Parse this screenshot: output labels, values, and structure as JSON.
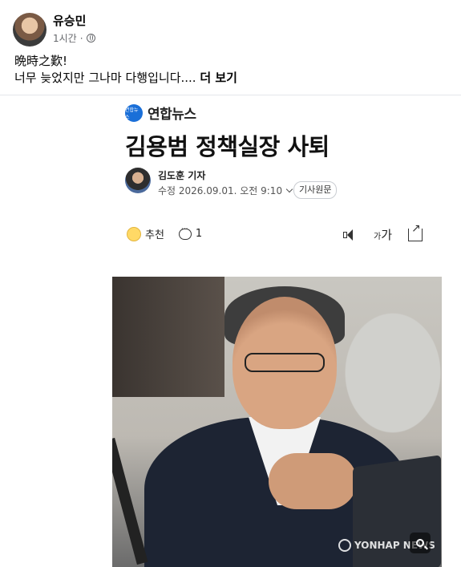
{
  "post": {
    "author": "유승민",
    "time": "1시간",
    "separator": "·",
    "privacy_icon": "globe-icon",
    "text_line1": "晩時之歎!",
    "text_line2": "너무 늦었지만 그나마 다행입니다....",
    "see_more": "더 보기"
  },
  "article": {
    "publisher_badge": "연합뉴스",
    "publisher": "연합뉴스",
    "headline": "김용범 정책실장 사퇴",
    "reporter": "김도훈 기자",
    "date": "수정 2026.09.01. 오전 9:10",
    "original_link": "기사원문",
    "recommend_label": "추천",
    "comment_count": "1",
    "font_small": "가",
    "font_large": "가",
    "watermark": "YONHAP NEWS"
  },
  "colors": {
    "publisher_blue": "#1a6fd8",
    "background": "#ffffff",
    "meta_gray": "#65676b"
  }
}
